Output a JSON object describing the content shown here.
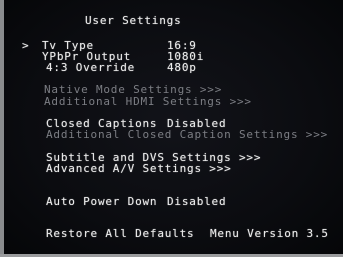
{
  "title": "User Settings",
  "cursor": ">",
  "menu": {
    "tv_type": {
      "label": "Tv Type",
      "value": "16:9"
    },
    "ypbpr_output": {
      "label": "YPbPr Output",
      "value": "1080i"
    },
    "override": {
      "label": "4:3 Override",
      "value": "480p"
    },
    "native_mode": {
      "label": "Native Mode Settings >>>"
    },
    "additional_hdmi": {
      "label": "Additional HDMI Settings >>>"
    },
    "closed_captions": {
      "label": "Closed Captions",
      "value": "Disabled"
    },
    "additional_cc": {
      "label": "Additional Closed Caption Settings >>>"
    },
    "subtitle_dvs": {
      "label": "Subtitle and DVS Settings >>>"
    },
    "advanced_av": {
      "label": "Advanced A/V Settings >>>"
    },
    "auto_power_down": {
      "label": "Auto Power Down",
      "value": "Disabled"
    },
    "restore_defaults": {
      "label": "Restore All Defaults"
    }
  },
  "footer": {
    "menu_version": "Menu Version 3.5"
  }
}
